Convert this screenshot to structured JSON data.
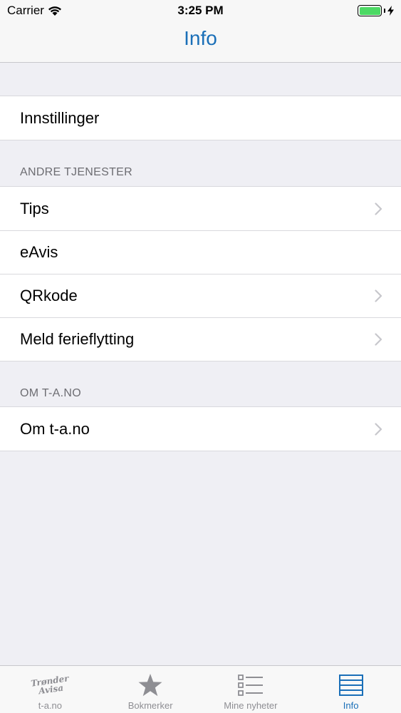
{
  "status_bar": {
    "carrier": "Carrier",
    "time": "3:25 PM",
    "battery_color": "#4cd964"
  },
  "nav": {
    "title": "Info",
    "title_color": "#1a6fb8"
  },
  "settings_group": {
    "items": [
      {
        "label": "Innstillinger"
      }
    ]
  },
  "services": {
    "header": "ANDRE TJENESTER",
    "items": [
      {
        "label": "Tips",
        "chevron": true
      },
      {
        "label": "eAvis",
        "chevron": false
      },
      {
        "label": "QRkode",
        "chevron": true
      },
      {
        "label": "Meld ferieflytting",
        "chevron": true
      }
    ]
  },
  "about": {
    "header": "OM T-A.NO",
    "items": [
      {
        "label": "Om t-a.no",
        "chevron": true
      }
    ]
  },
  "tabbar": {
    "active_color": "#1a6fb8",
    "inactive_color": "#8e8e93",
    "tabs": [
      {
        "label": "t-a.no",
        "icon": "tronder-avisa-logo-icon",
        "logo_line1": "Trønder",
        "logo_line2": "Avisa",
        "active": false
      },
      {
        "label": "Bokmerker",
        "icon": "star-icon",
        "active": false
      },
      {
        "label": "Mine nyheter",
        "icon": "checklist-icon",
        "active": false
      },
      {
        "label": "Info",
        "icon": "list-lines-icon",
        "active": true
      }
    ]
  }
}
